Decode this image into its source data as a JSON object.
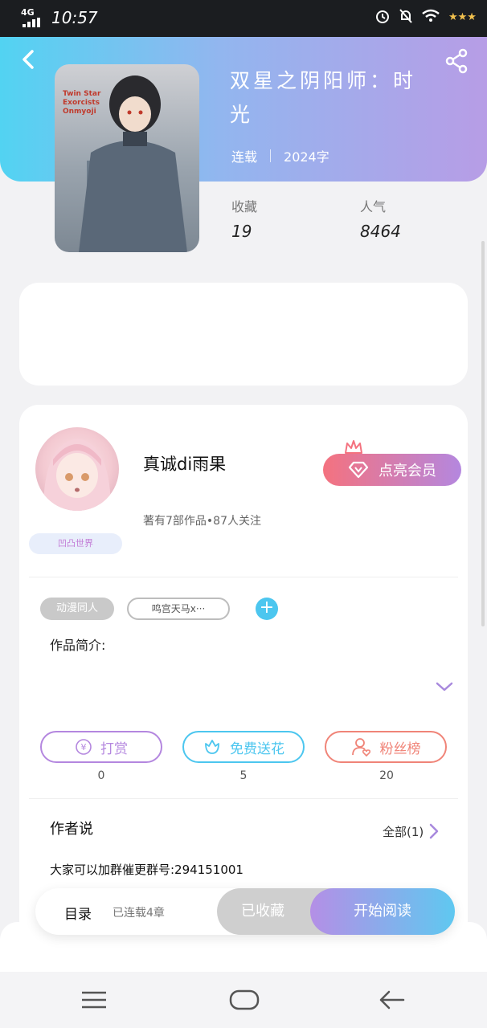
{
  "status_bar": {
    "network": "4G",
    "time": "10:57"
  },
  "book": {
    "title": "双星之阴阳师：时光",
    "status": "连载",
    "word_count": "2024字",
    "cover_text": "Twin Star Exorcists Onmyoji",
    "stats": {
      "favorites_label": "收藏",
      "favorites_value": "19",
      "popularity_label": "人气",
      "popularity_value": "8464"
    }
  },
  "author": {
    "name": "真诚di雨果",
    "summary": "著有7部作品•87人关注",
    "badge": "凹凸世界",
    "vip_button": "点亮会员"
  },
  "tags": {
    "category": "动漫同人",
    "custom": "鸣宫天马x···"
  },
  "intro": {
    "label": "作品简介:"
  },
  "actions": [
    {
      "label": "打赏",
      "count": "0",
      "color": "#b487df",
      "icon": "yen-icon"
    },
    {
      "label": "免费送花",
      "count": "5",
      "color": "#4cc6ef",
      "icon": "flower-icon"
    },
    {
      "label": "粉丝榜",
      "count": "20",
      "color": "#f08478",
      "icon": "fans-icon"
    }
  ],
  "author_says": {
    "title": "作者说",
    "all_label": "全部(1)",
    "text": "大家可以加群催更群号:294151001"
  },
  "read_bar": {
    "toc_label": "目录",
    "toc_status": "已连载4章",
    "collected_label": "已收藏",
    "start_label": "开始阅读"
  },
  "colors": {
    "header_gradient_start": "#52d3f2",
    "header_gradient_end": "#b79de6",
    "accent_purple": "#b487df",
    "accent_blue": "#4cc6ef",
    "accent_red": "#f4727f"
  }
}
